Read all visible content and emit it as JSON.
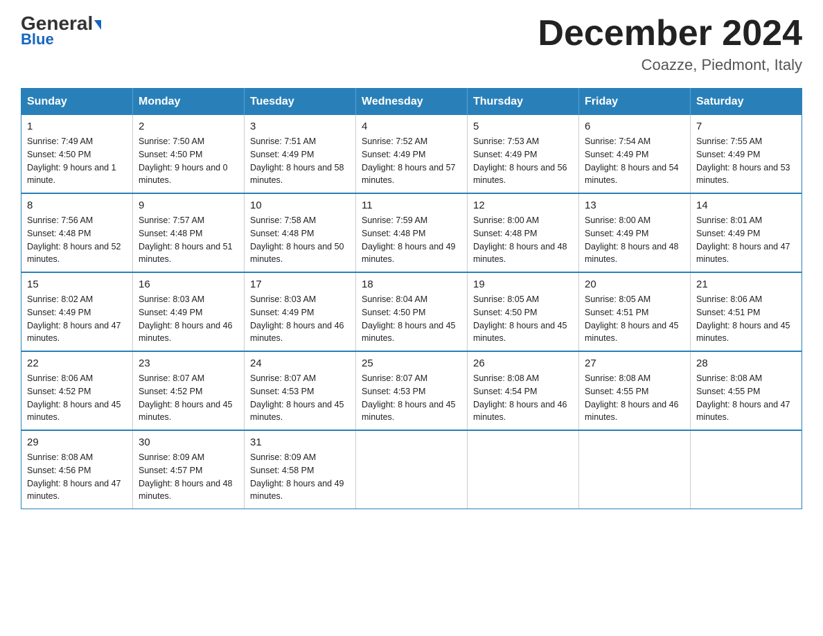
{
  "logo": {
    "part1": "General",
    "part2": "Blue"
  },
  "title": "December 2024",
  "location": "Coazze, Piedmont, Italy",
  "weekdays": [
    "Sunday",
    "Monday",
    "Tuesday",
    "Wednesday",
    "Thursday",
    "Friday",
    "Saturday"
  ],
  "weeks": [
    [
      {
        "day": "1",
        "sunrise": "7:49 AM",
        "sunset": "4:50 PM",
        "daylight": "9 hours and 1 minute."
      },
      {
        "day": "2",
        "sunrise": "7:50 AM",
        "sunset": "4:50 PM",
        "daylight": "9 hours and 0 minutes."
      },
      {
        "day": "3",
        "sunrise": "7:51 AM",
        "sunset": "4:49 PM",
        "daylight": "8 hours and 58 minutes."
      },
      {
        "day": "4",
        "sunrise": "7:52 AM",
        "sunset": "4:49 PM",
        "daylight": "8 hours and 57 minutes."
      },
      {
        "day": "5",
        "sunrise": "7:53 AM",
        "sunset": "4:49 PM",
        "daylight": "8 hours and 56 minutes."
      },
      {
        "day": "6",
        "sunrise": "7:54 AM",
        "sunset": "4:49 PM",
        "daylight": "8 hours and 54 minutes."
      },
      {
        "day": "7",
        "sunrise": "7:55 AM",
        "sunset": "4:49 PM",
        "daylight": "8 hours and 53 minutes."
      }
    ],
    [
      {
        "day": "8",
        "sunrise": "7:56 AM",
        "sunset": "4:48 PM",
        "daylight": "8 hours and 52 minutes."
      },
      {
        "day": "9",
        "sunrise": "7:57 AM",
        "sunset": "4:48 PM",
        "daylight": "8 hours and 51 minutes."
      },
      {
        "day": "10",
        "sunrise": "7:58 AM",
        "sunset": "4:48 PM",
        "daylight": "8 hours and 50 minutes."
      },
      {
        "day": "11",
        "sunrise": "7:59 AM",
        "sunset": "4:48 PM",
        "daylight": "8 hours and 49 minutes."
      },
      {
        "day": "12",
        "sunrise": "8:00 AM",
        "sunset": "4:48 PM",
        "daylight": "8 hours and 48 minutes."
      },
      {
        "day": "13",
        "sunrise": "8:00 AM",
        "sunset": "4:49 PM",
        "daylight": "8 hours and 48 minutes."
      },
      {
        "day": "14",
        "sunrise": "8:01 AM",
        "sunset": "4:49 PM",
        "daylight": "8 hours and 47 minutes."
      }
    ],
    [
      {
        "day": "15",
        "sunrise": "8:02 AM",
        "sunset": "4:49 PM",
        "daylight": "8 hours and 47 minutes."
      },
      {
        "day": "16",
        "sunrise": "8:03 AM",
        "sunset": "4:49 PM",
        "daylight": "8 hours and 46 minutes."
      },
      {
        "day": "17",
        "sunrise": "8:03 AM",
        "sunset": "4:49 PM",
        "daylight": "8 hours and 46 minutes."
      },
      {
        "day": "18",
        "sunrise": "8:04 AM",
        "sunset": "4:50 PM",
        "daylight": "8 hours and 45 minutes."
      },
      {
        "day": "19",
        "sunrise": "8:05 AM",
        "sunset": "4:50 PM",
        "daylight": "8 hours and 45 minutes."
      },
      {
        "day": "20",
        "sunrise": "8:05 AM",
        "sunset": "4:51 PM",
        "daylight": "8 hours and 45 minutes."
      },
      {
        "day": "21",
        "sunrise": "8:06 AM",
        "sunset": "4:51 PM",
        "daylight": "8 hours and 45 minutes."
      }
    ],
    [
      {
        "day": "22",
        "sunrise": "8:06 AM",
        "sunset": "4:52 PM",
        "daylight": "8 hours and 45 minutes."
      },
      {
        "day": "23",
        "sunrise": "8:07 AM",
        "sunset": "4:52 PM",
        "daylight": "8 hours and 45 minutes."
      },
      {
        "day": "24",
        "sunrise": "8:07 AM",
        "sunset": "4:53 PM",
        "daylight": "8 hours and 45 minutes."
      },
      {
        "day": "25",
        "sunrise": "8:07 AM",
        "sunset": "4:53 PM",
        "daylight": "8 hours and 45 minutes."
      },
      {
        "day": "26",
        "sunrise": "8:08 AM",
        "sunset": "4:54 PM",
        "daylight": "8 hours and 46 minutes."
      },
      {
        "day": "27",
        "sunrise": "8:08 AM",
        "sunset": "4:55 PM",
        "daylight": "8 hours and 46 minutes."
      },
      {
        "day": "28",
        "sunrise": "8:08 AM",
        "sunset": "4:55 PM",
        "daylight": "8 hours and 47 minutes."
      }
    ],
    [
      {
        "day": "29",
        "sunrise": "8:08 AM",
        "sunset": "4:56 PM",
        "daylight": "8 hours and 47 minutes."
      },
      {
        "day": "30",
        "sunrise": "8:09 AM",
        "sunset": "4:57 PM",
        "daylight": "8 hours and 48 minutes."
      },
      {
        "day": "31",
        "sunrise": "8:09 AM",
        "sunset": "4:58 PM",
        "daylight": "8 hours and 49 minutes."
      },
      null,
      null,
      null,
      null
    ]
  ]
}
